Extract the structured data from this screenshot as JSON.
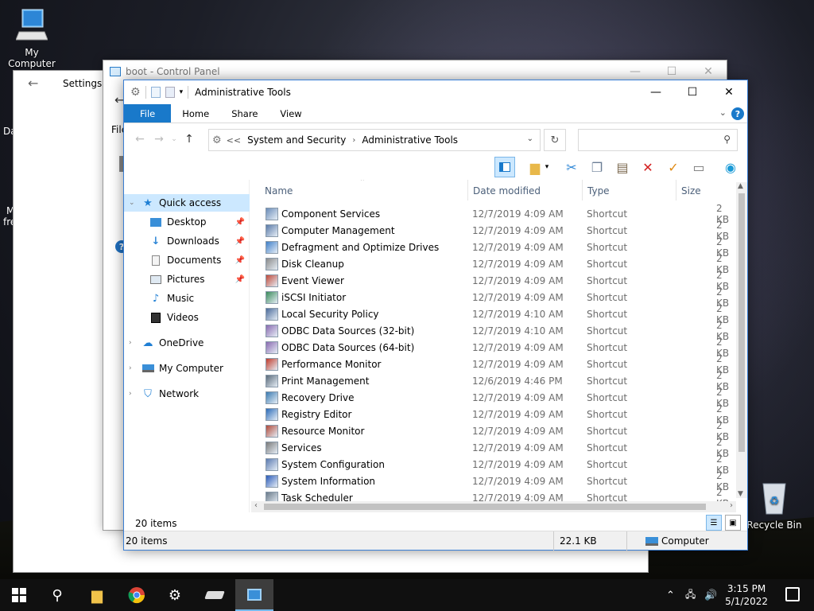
{
  "desktop": {
    "icons": [
      {
        "label": "My Computer",
        "icon": "computer-icon"
      },
      {
        "label": "Recycle Bin",
        "icon": "recycle-bin-icon"
      }
    ],
    "side_fragments": [
      "Da",
      "M",
      "fre"
    ]
  },
  "settings_window": {
    "title": "Settings"
  },
  "control_panel_window": {
    "title": "boot - Control Panel",
    "menu_fragment": "File"
  },
  "explorer": {
    "title": "Administrative Tools",
    "ribbon_tabs": [
      "File",
      "Home",
      "Share",
      "View"
    ],
    "address": {
      "prefix": "<<",
      "crumbs": [
        "System and Security",
        "Administrative Tools"
      ]
    },
    "search_placeholder": "",
    "nav": [
      {
        "label": "Quick access",
        "icon": "star-icon",
        "level": 0,
        "expanded": true
      },
      {
        "label": "Desktop",
        "icon": "desktop-icon",
        "level": 1,
        "pinned": true
      },
      {
        "label": "Downloads",
        "icon": "download-icon",
        "level": 1,
        "pinned": true
      },
      {
        "label": "Documents",
        "icon": "document-icon",
        "level": 1,
        "pinned": true
      },
      {
        "label": "Pictures",
        "icon": "pictures-icon",
        "level": 1,
        "pinned": true
      },
      {
        "label": "Music",
        "icon": "music-icon",
        "level": 1
      },
      {
        "label": "Videos",
        "icon": "video-icon",
        "level": 1
      },
      {
        "label": "OneDrive",
        "icon": "cloud-icon",
        "level": 0
      },
      {
        "label": "My Computer",
        "icon": "computer-icon",
        "level": 0
      },
      {
        "label": "Network",
        "icon": "network-icon",
        "level": 0
      }
    ],
    "columns": [
      "Name",
      "Date modified",
      "Type",
      "Size"
    ],
    "files": [
      {
        "name": "Component Services",
        "date": "12/7/2019 4:09 AM",
        "type": "Shortcut",
        "size": "2 KB"
      },
      {
        "name": "Computer Management",
        "date": "12/7/2019 4:09 AM",
        "type": "Shortcut",
        "size": "2 KB"
      },
      {
        "name": "Defragment and Optimize Drives",
        "date": "12/7/2019 4:09 AM",
        "type": "Shortcut",
        "size": "2 KB"
      },
      {
        "name": "Disk Cleanup",
        "date": "12/7/2019 4:09 AM",
        "type": "Shortcut",
        "size": "2 KB"
      },
      {
        "name": "Event Viewer",
        "date": "12/7/2019 4:09 AM",
        "type": "Shortcut",
        "size": "2 KB"
      },
      {
        "name": "iSCSI Initiator",
        "date": "12/7/2019 4:09 AM",
        "type": "Shortcut",
        "size": "2 KB"
      },
      {
        "name": "Local Security Policy",
        "date": "12/7/2019 4:10 AM",
        "type": "Shortcut",
        "size": "2 KB"
      },
      {
        "name": "ODBC Data Sources (32-bit)",
        "date": "12/7/2019 4:10 AM",
        "type": "Shortcut",
        "size": "2 KB"
      },
      {
        "name": "ODBC Data Sources (64-bit)",
        "date": "12/7/2019 4:09 AM",
        "type": "Shortcut",
        "size": "2 KB"
      },
      {
        "name": "Performance Monitor",
        "date": "12/7/2019 4:09 AM",
        "type": "Shortcut",
        "size": "2 KB"
      },
      {
        "name": "Print Management",
        "date": "12/6/2019 4:46 PM",
        "type": "Shortcut",
        "size": "2 KB"
      },
      {
        "name": "Recovery Drive",
        "date": "12/7/2019 4:09 AM",
        "type": "Shortcut",
        "size": "2 KB"
      },
      {
        "name": "Registry Editor",
        "date": "12/7/2019 4:09 AM",
        "type": "Shortcut",
        "size": "2 KB"
      },
      {
        "name": "Resource Monitor",
        "date": "12/7/2019 4:09 AM",
        "type": "Shortcut",
        "size": "2 KB"
      },
      {
        "name": "Services",
        "date": "12/7/2019 4:09 AM",
        "type": "Shortcut",
        "size": "2 KB"
      },
      {
        "name": "System Configuration",
        "date": "12/7/2019 4:09 AM",
        "type": "Shortcut",
        "size": "2 KB"
      },
      {
        "name": "System Information",
        "date": "12/7/2019 4:09 AM",
        "type": "Shortcut",
        "size": "2 KB"
      },
      {
        "name": "Task Scheduler",
        "date": "12/7/2019 4:09 AM",
        "type": "Shortcut",
        "size": "2 KB"
      }
    ],
    "status_items": "20 items",
    "status_bar": {
      "items": "20 items",
      "size": "22.1 KB",
      "location": "Computer"
    }
  },
  "taskbar": {
    "clock_time": "3:15 PM",
    "clock_date": "5/1/2022"
  },
  "colors": {
    "accent": "#1979ca",
    "selection": "#cce8ff"
  }
}
